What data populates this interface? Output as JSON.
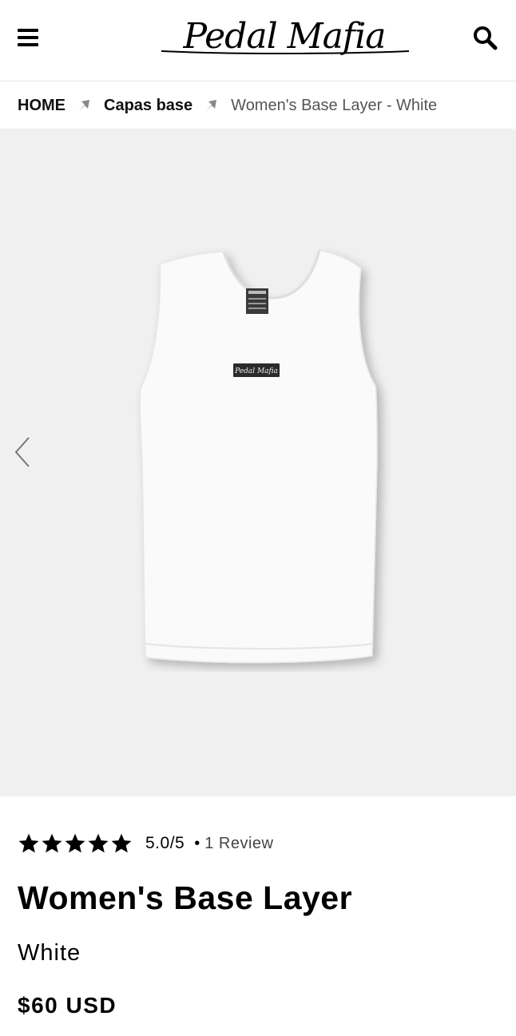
{
  "header": {
    "brand": "Pedal Mafia",
    "menu_icon": "hamburger-menu-icon",
    "search_icon": "search-icon"
  },
  "breadcrumb": {
    "items": [
      {
        "label": "HOME"
      },
      {
        "label": "Capas base"
      },
      {
        "label": "Women's Base Layer - White"
      }
    ],
    "separator_icon": "chevron-arrow-icon"
  },
  "gallery": {
    "prev_icon": "chevron-left-icon",
    "background": "#f0f0f0",
    "product_tag": "Pedal Mafia"
  },
  "product": {
    "rating_score": "5.0/5",
    "stars_filled": 5,
    "review_count": "1 Review",
    "title": "Women's Base Layer",
    "variant": "White",
    "price": "$60 USD"
  }
}
